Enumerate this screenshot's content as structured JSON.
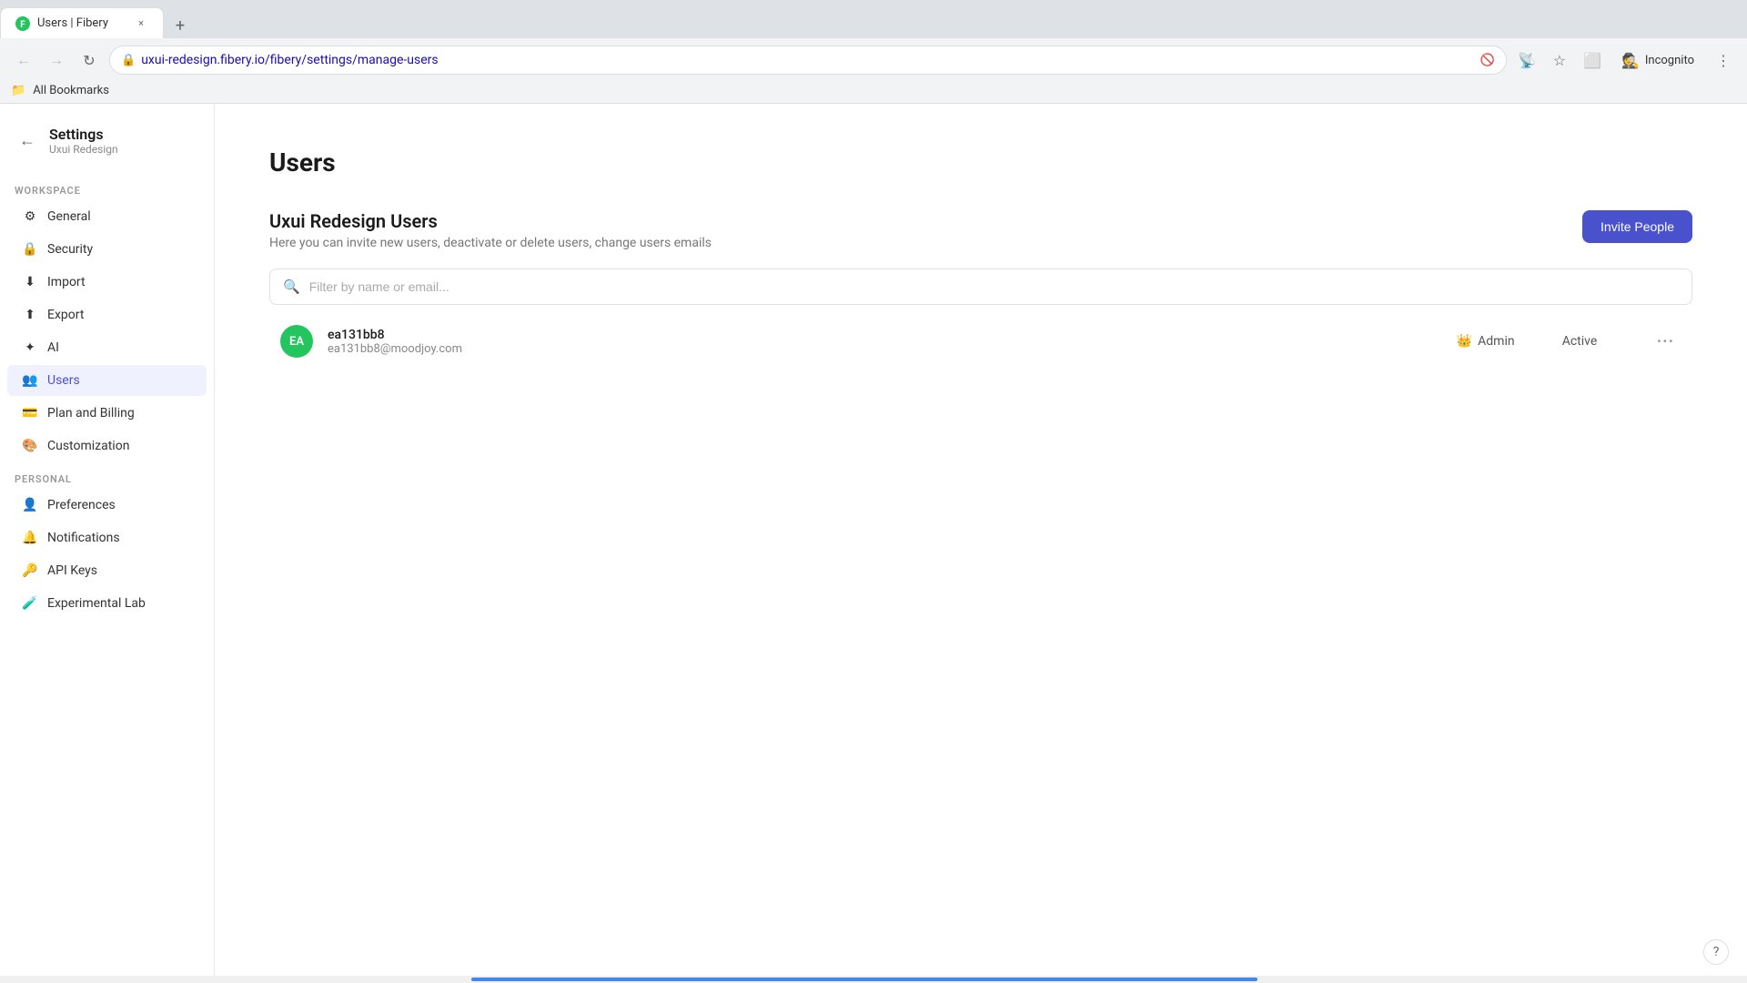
{
  "browser": {
    "tab": {
      "title": "Users | Fibery",
      "favicon": "F",
      "close_label": "×"
    },
    "new_tab_label": "+",
    "address": "uxui-redesign.fibery.io/fibery/settings/manage-users",
    "nav": {
      "back_title": "Back",
      "forward_title": "Forward",
      "reload_title": "Reload"
    },
    "incognito_label": "Incognito",
    "bookmarks_label": "All Bookmarks"
  },
  "sidebar": {
    "settings_label": "Settings",
    "workspace_label": "Uxui Redesign",
    "workspace_section": "WORKSPACE",
    "personal_section": "PERSONAL",
    "items_workspace": [
      {
        "id": "general",
        "label": "General"
      },
      {
        "id": "security",
        "label": "Security"
      },
      {
        "id": "import",
        "label": "Import"
      },
      {
        "id": "export",
        "label": "Export"
      },
      {
        "id": "ai",
        "label": "AI"
      },
      {
        "id": "users",
        "label": "Users",
        "active": true
      },
      {
        "id": "plan-billing",
        "label": "Plan and Billing"
      },
      {
        "id": "customization",
        "label": "Customization"
      }
    ],
    "items_personal": [
      {
        "id": "preferences",
        "label": "Preferences"
      },
      {
        "id": "notifications",
        "label": "Notifications"
      },
      {
        "id": "api-keys",
        "label": "API Keys"
      },
      {
        "id": "experimental-lab",
        "label": "Experimental Lab"
      }
    ]
  },
  "main": {
    "page_title": "Users",
    "section_title": "Uxui Redesign Users",
    "section_desc": "Here you can invite new users, deactivate or delete users, change users emails",
    "invite_button": "Invite People",
    "search_placeholder": "Filter by name or email...",
    "users": [
      {
        "id": "ea131bb8",
        "name": "ea131bb8",
        "email": "ea131bb8@moodjoy.com",
        "role": "Admin",
        "status": "Active",
        "avatar_initials": "EA",
        "avatar_color": "#22c55e"
      }
    ]
  },
  "icons": {
    "search": "🔍",
    "crown": "👑",
    "general": "⚙",
    "security": "🔒",
    "import": "⬇",
    "export": "⬆",
    "ai": "✦",
    "users": "👥",
    "plan": "💳",
    "customization": "🎨",
    "preferences": "👤",
    "notifications": "🔔",
    "api": "🔑",
    "lab": "🧪",
    "more": "···"
  },
  "help_label": "?"
}
